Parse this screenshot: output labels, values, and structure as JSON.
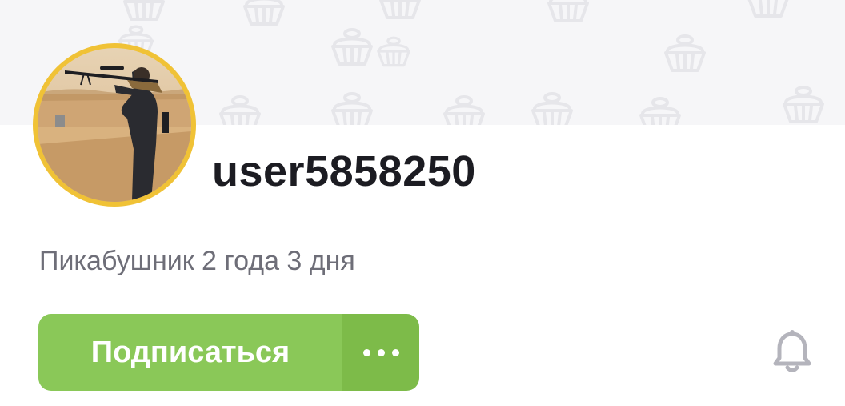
{
  "profile": {
    "username": "user5858250",
    "tenure": "Пикабушник 2 года 3 дня"
  },
  "actions": {
    "subscribe_label": "Подписаться",
    "more_icon": "more-dots-icon",
    "notifications_icon": "bell-icon"
  },
  "colors": {
    "accent_green": "#8ac858",
    "accent_green_dark": "#7dbb49",
    "avatar_ring": "#f0c236",
    "cover_bg": "#f6f6f8",
    "text_primary": "#1c1c22",
    "text_secondary": "#6e6e78",
    "icon_gray": "#b4b4bc"
  }
}
